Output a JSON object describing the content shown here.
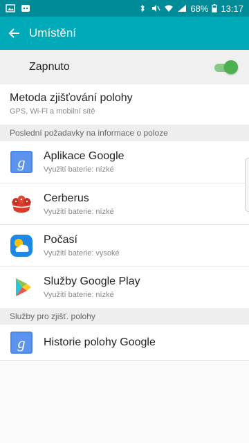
{
  "status_bar": {
    "battery": "68%",
    "time": "13:17"
  },
  "app_bar": {
    "title": "Umístění"
  },
  "toggle": {
    "label": "Zapnuto",
    "on": true
  },
  "method": {
    "title": "Metoda zjišťování polohy",
    "subtitle": "GPS, Wi-Fi a mobilní sítě"
  },
  "recent_requests": {
    "header": "Poslední požadavky na informace o poloze",
    "items": [
      {
        "title": "Aplikace Google",
        "subtitle": "Využití baterie: nízké",
        "icon": "google-app-icon"
      },
      {
        "title": "Cerberus",
        "subtitle": "Využití baterie: nízké",
        "icon": "cerberus-icon"
      },
      {
        "title": "Počasí",
        "subtitle": "Využití baterie: vysoké",
        "icon": "weather-icon"
      },
      {
        "title": "Služby Google Play",
        "subtitle": "Využití baterie: nízké",
        "icon": "google-play-services-icon"
      }
    ]
  },
  "location_services": {
    "header": "Služby pro zjišť. polohy",
    "items": [
      {
        "title": "Historie polohy Google",
        "icon": "google-app-icon"
      }
    ]
  },
  "colors": {
    "status_bar": "#008b99",
    "app_bar": "#00aab9",
    "toggle_on": "#4caf50"
  }
}
